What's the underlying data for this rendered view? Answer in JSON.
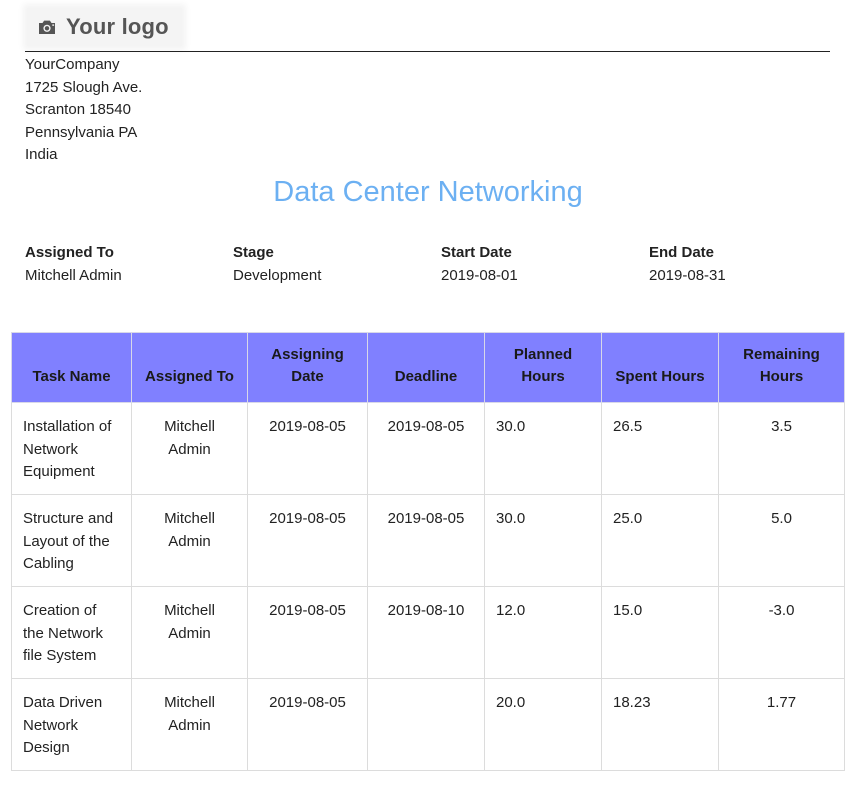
{
  "logo": {
    "text": "Your logo",
    "icon": "camera-icon"
  },
  "company": {
    "name": "YourCompany",
    "street": "1725 Slough Ave.",
    "city_zip": "Scranton 18540",
    "state": "Pennsylvania PA",
    "country": "India"
  },
  "title": "Data Center Networking",
  "info": {
    "assigned_to_label": "Assigned To",
    "assigned_to_value": "Mitchell Admin",
    "stage_label": "Stage",
    "stage_value": "Development",
    "start_date_label": "Start Date",
    "start_date_value": "2019-08-01",
    "end_date_label": "End Date",
    "end_date_value": "2019-08-31"
  },
  "table": {
    "headers": {
      "task_name": "Task Name",
      "assigned_to": "Assigned To",
      "assigning_date": "Assigning Date",
      "deadline": "Deadline",
      "planned_hours": "Planned Hours",
      "spent_hours": "Spent Hours",
      "remaining_hours": "Remaining Hours"
    },
    "rows": [
      {
        "task_name": "Installation of Network Equipment",
        "assigned_to": "Mitchell Admin",
        "assigning_date": "2019-08-05",
        "deadline": "2019-08-05",
        "planned_hours": "30.0",
        "spent_hours": "26.5",
        "remaining_hours": "3.5"
      },
      {
        "task_name": "Structure and Layout of the Cabling",
        "assigned_to": "Mitchell Admin",
        "assigning_date": "2019-08-05",
        "deadline": "2019-08-05",
        "planned_hours": "30.0",
        "spent_hours": "25.0",
        "remaining_hours": "5.0"
      },
      {
        "task_name": "Creation of the Network file System",
        "assigned_to": "Mitchell Admin",
        "assigning_date": "2019-08-05",
        "deadline": "2019-08-10",
        "planned_hours": "12.0",
        "spent_hours": "15.0",
        "remaining_hours": "-3.0"
      },
      {
        "task_name": "Data Driven Network Design",
        "assigned_to": "Mitchell Admin",
        "assigning_date": "2019-08-05",
        "deadline": "",
        "planned_hours": "20.0",
        "spent_hours": "18.23",
        "remaining_hours": "1.77"
      }
    ]
  },
  "colors": {
    "title": "#6cb0f2",
    "table_header_bg": "#8080ff"
  }
}
